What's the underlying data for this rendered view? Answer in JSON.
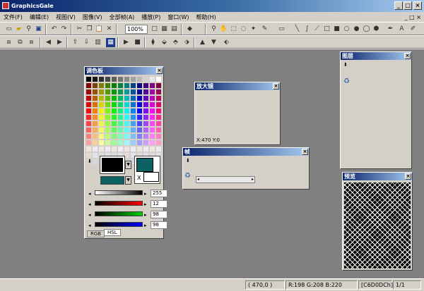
{
  "window": {
    "title": "GraphicsGale",
    "min": "_",
    "max": "□",
    "close": "×"
  },
  "menu": [
    "文件(F)",
    "编辑(E)",
    "视图(V)",
    "图像(V)",
    "全部帧(A)",
    "播放(P)",
    "窗口(W)",
    "帮助(H)"
  ],
  "toolbar1": {
    "zoom": "100%",
    "icons": [
      "new-icon",
      "open-icon",
      "zoom-icon",
      "save-icon",
      "undo-icon",
      "redo-icon",
      "cut-icon",
      "copy-icon",
      "paste-icon",
      "delete-icon"
    ],
    "tools": [
      "search-icon",
      "hand-icon",
      "select-rect-icon",
      "lasso-icon",
      "wand-icon",
      "pen-icon",
      "dropper-icon",
      "rect-fill-icon",
      "circle-fill-icon",
      "text-icon"
    ]
  },
  "toolbar2": {
    "icons": [
      "frame-icon",
      "prev-icon",
      "next-icon",
      "play-icon",
      "stop-icon",
      "layer-icon",
      "up-icon",
      "down-icon"
    ]
  },
  "palette": {
    "title": "调色板",
    "tabs": [
      "RGB",
      "HSL"
    ],
    "values": {
      "alpha": "255",
      "r": "12",
      "g": "98",
      "b": "98"
    },
    "x_label": "X"
  },
  "magnifier": {
    "title": "放大镜",
    "coord": "X:470 Y:0"
  },
  "frame": {
    "title": "帧"
  },
  "layer": {
    "title": "图层"
  },
  "preview": {
    "title": "预览"
  },
  "status": {
    "coord": "( 470,0 )",
    "rgb": "R:198  G:208  B:220",
    "hex": "[C6D0DCh]",
    "zoom": "1/1"
  },
  "colors": {
    "fg": "#0c6262",
    "bg": "#000000"
  }
}
